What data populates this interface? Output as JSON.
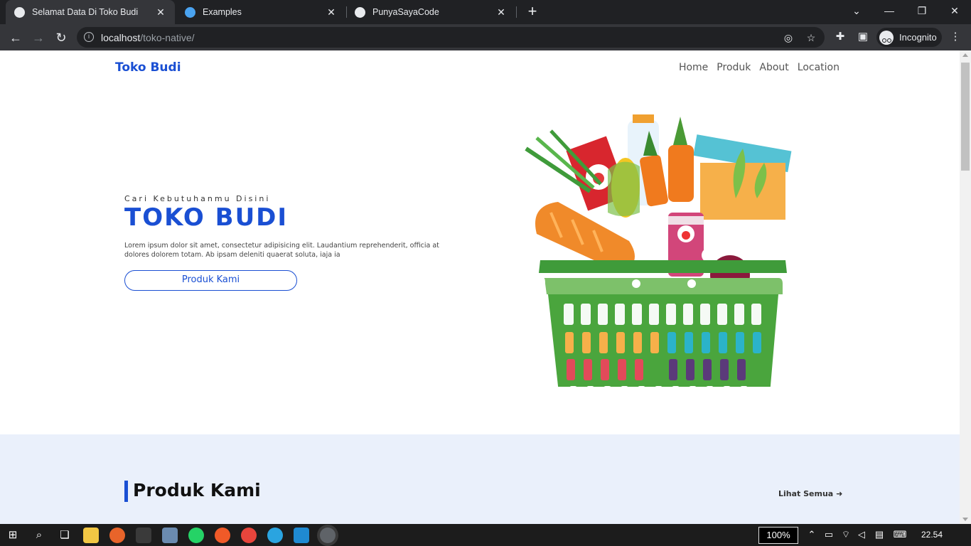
{
  "browser": {
    "tabs": [
      {
        "title": "Selamat Data Di Toko Budi",
        "active": true
      },
      {
        "title": "Examples",
        "active": false
      },
      {
        "title": "PunyaSayaCode",
        "active": false
      }
    ],
    "url_host": "localhost",
    "url_path": "/toko-native/",
    "incognito_label": "Incognito"
  },
  "site": {
    "brand": "Toko Budi",
    "nav": [
      "Home",
      "Produk",
      "About",
      "Location"
    ],
    "hero": {
      "subtitle": "Cari Kebutuhanmu Disini",
      "title": "TOKO BUDI",
      "description": "Lorem ipsum dolor sit amet, consectetur adipisicing elit. Laudantium reprehenderit, officia at dolores dolorem totam. Ab ipsam deleniti quaerat soluta, iaja ia",
      "button": "Produk Kami"
    },
    "products": {
      "heading": "Produk Kami",
      "see_all": "Lihat Semua"
    }
  },
  "taskbar": {
    "zoom": "100%",
    "clock": "22.54"
  },
  "colors": {
    "accent": "#1a4fd3",
    "section_bg": "#eaf0fb"
  }
}
